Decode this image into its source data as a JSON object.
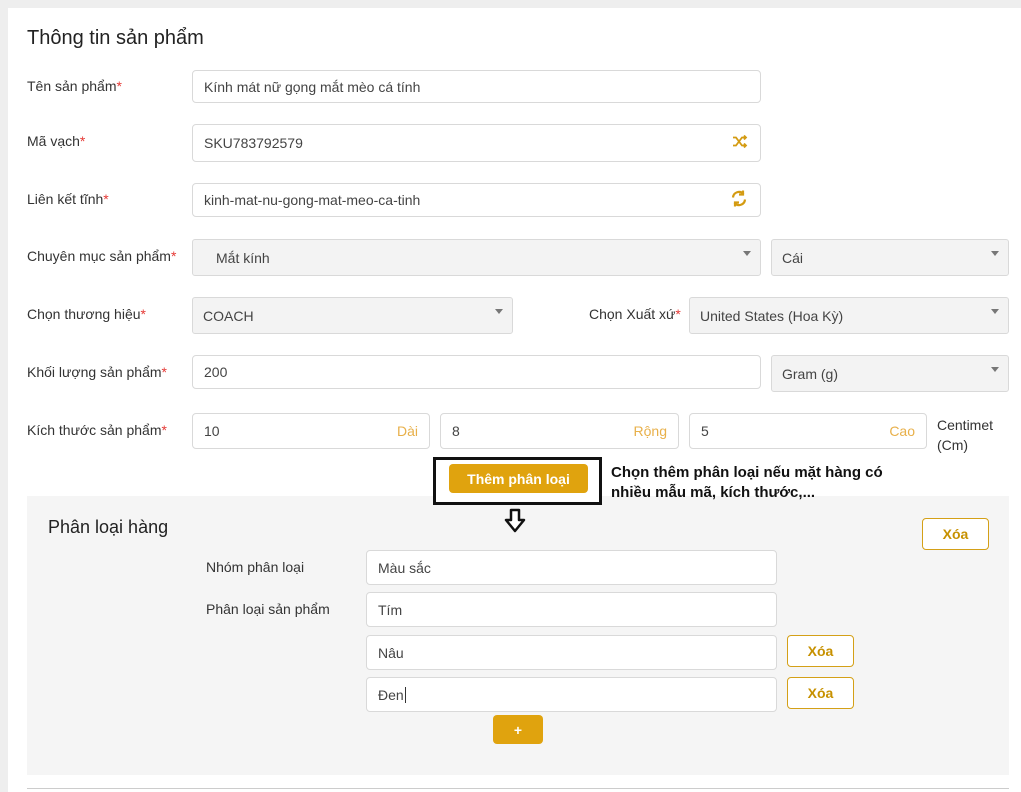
{
  "page_title": "Thông tin sản phẩm",
  "required_mark": "*",
  "fields": {
    "name": {
      "label": "Tên sản phẩm",
      "value": "Kính mát nữ gọng mắt mèo cá tính"
    },
    "barcode": {
      "label": "Mã vạch",
      "value": "SKU783792579",
      "icon": "shuffle-icon"
    },
    "slug": {
      "label": "Liên kết tĩnh",
      "value": "kinh-mat-nu-gong-mat-meo-ca-tinh",
      "icon": "refresh-icon"
    },
    "category": {
      "label": "Chuyên mục sản phẩm",
      "value": "Mắt kính",
      "unit": "Cái"
    },
    "brand": {
      "label": "Chọn thương hiệu",
      "value": "COACH"
    },
    "origin": {
      "label": "Chọn Xuất xứ",
      "value": "United States (Hoa Kỳ)"
    },
    "weight": {
      "label": "Khối lượng sản phẩm",
      "value": "200",
      "unit": "Gram (g)"
    },
    "size": {
      "label": "Kích thước sản phẩm",
      "length": {
        "value": "10",
        "suffix": "Dài"
      },
      "width": {
        "value": "8",
        "suffix": "Rộng"
      },
      "height": {
        "value": "5",
        "suffix": "Cao"
      },
      "unit_line1": "Centimet",
      "unit_line2": "(Cm)"
    }
  },
  "add_variant_button": "Thêm phân loại",
  "hint": "Chọn thêm phân loại nếu mặt hàng có nhiều mẫu mã, kích thước,...",
  "variant_section": {
    "title": "Phân loại hàng",
    "delete_label": "Xóa",
    "group_label": "Nhóm phân loại",
    "group_value": "Màu sắc",
    "options_label": "Phân loại sản phẩm",
    "options": [
      "Tím",
      "Nâu",
      "Đen"
    ],
    "option_delete_label": "Xóa",
    "add_option_label": "+"
  },
  "colors": {
    "accent": "#e0a30e",
    "required": "#e53935"
  }
}
